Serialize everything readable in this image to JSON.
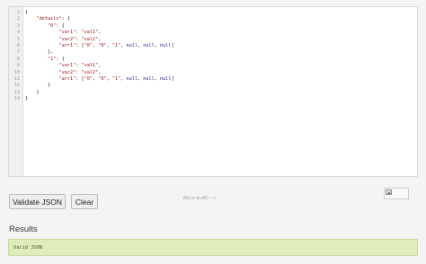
{
  "editor": {
    "line_numbers": [
      "1",
      "2",
      "3",
      "4",
      "5",
      "6",
      "7",
      "8",
      "9",
      "10",
      "11",
      "12",
      "13",
      "14"
    ],
    "lines": [
      [
        {
          "t": "p",
          "v": "{"
        }
      ],
      [
        {
          "t": "p",
          "v": "    "
        },
        {
          "t": "k",
          "v": "\"details\""
        },
        {
          "t": "p",
          "v": ": {"
        }
      ],
      [
        {
          "t": "p",
          "v": "        "
        },
        {
          "t": "k",
          "v": "\"0\""
        },
        {
          "t": "p",
          "v": ": {"
        }
      ],
      [
        {
          "t": "p",
          "v": "            "
        },
        {
          "t": "k",
          "v": "\"var1\""
        },
        {
          "t": "p",
          "v": ": "
        },
        {
          "t": "s",
          "v": "\"val1\""
        },
        {
          "t": "p",
          "v": ","
        }
      ],
      [
        {
          "t": "p",
          "v": "            "
        },
        {
          "t": "k",
          "v": "\"var2\""
        },
        {
          "t": "p",
          "v": ": "
        },
        {
          "t": "s",
          "v": "\"val2\""
        },
        {
          "t": "p",
          "v": ","
        }
      ],
      [
        {
          "t": "p",
          "v": "            "
        },
        {
          "t": "k",
          "v": "\"arr1\""
        },
        {
          "t": "p",
          "v": ": ["
        },
        {
          "t": "s",
          "v": "\"0\""
        },
        {
          "t": "p",
          "v": ", "
        },
        {
          "t": "s",
          "v": "\"0\""
        },
        {
          "t": "p",
          "v": ", "
        },
        {
          "t": "s",
          "v": "\"1\""
        },
        {
          "t": "p",
          "v": ", "
        },
        {
          "t": "n",
          "v": "null"
        },
        {
          "t": "p",
          "v": ", "
        },
        {
          "t": "n",
          "v": "null"
        },
        {
          "t": "p",
          "v": ", "
        },
        {
          "t": "n",
          "v": "null"
        },
        {
          "t": "p",
          "v": "]"
        }
      ],
      [
        {
          "t": "p",
          "v": "        },"
        }
      ],
      [
        {
          "t": "p",
          "v": "        "
        },
        {
          "t": "k",
          "v": "\"1\""
        },
        {
          "t": "p",
          "v": ": {"
        }
      ],
      [
        {
          "t": "p",
          "v": "            "
        },
        {
          "t": "k",
          "v": "\"var1\""
        },
        {
          "t": "p",
          "v": ": "
        },
        {
          "t": "s",
          "v": "\"val1\""
        },
        {
          "t": "p",
          "v": ","
        }
      ],
      [
        {
          "t": "p",
          "v": "            "
        },
        {
          "t": "k",
          "v": "\"var2\""
        },
        {
          "t": "p",
          "v": ": "
        },
        {
          "t": "s",
          "v": "\"val2\""
        },
        {
          "t": "p",
          "v": ","
        }
      ],
      [
        {
          "t": "p",
          "v": "            "
        },
        {
          "t": "k",
          "v": "\"arr1\""
        },
        {
          "t": "p",
          "v": ": ["
        },
        {
          "t": "s",
          "v": "\"0\""
        },
        {
          "t": "p",
          "v": ", "
        },
        {
          "t": "s",
          "v": "\"0\""
        },
        {
          "t": "p",
          "v": ", "
        },
        {
          "t": "s",
          "v": "\"1\""
        },
        {
          "t": "p",
          "v": ", "
        },
        {
          "t": "n",
          "v": "null"
        },
        {
          "t": "p",
          "v": ", "
        },
        {
          "t": "n",
          "v": "null"
        },
        {
          "t": "p",
          "v": ", "
        },
        {
          "t": "n",
          "v": "null"
        },
        {
          "t": "p",
          "v": "]"
        }
      ],
      [
        {
          "t": "p",
          "v": "        }"
        }
      ],
      [
        {
          "t": "p",
          "v": "    }"
        }
      ],
      [
        {
          "t": "p",
          "v": "}"
        }
      ]
    ]
  },
  "toolbar": {
    "validate_label": "Validate JSON",
    "clear_label": "Clear"
  },
  "ad": {
    "text": "this is an AD --->",
    "image_icon": "broken-image-icon"
  },
  "results": {
    "heading": "Results",
    "message": "Valid JSON"
  },
  "colors": {
    "result_bg": "#dfedbd",
    "result_text": "#3c5a16",
    "json_key": "#a31515",
    "json_null": "#1a1a8c"
  }
}
